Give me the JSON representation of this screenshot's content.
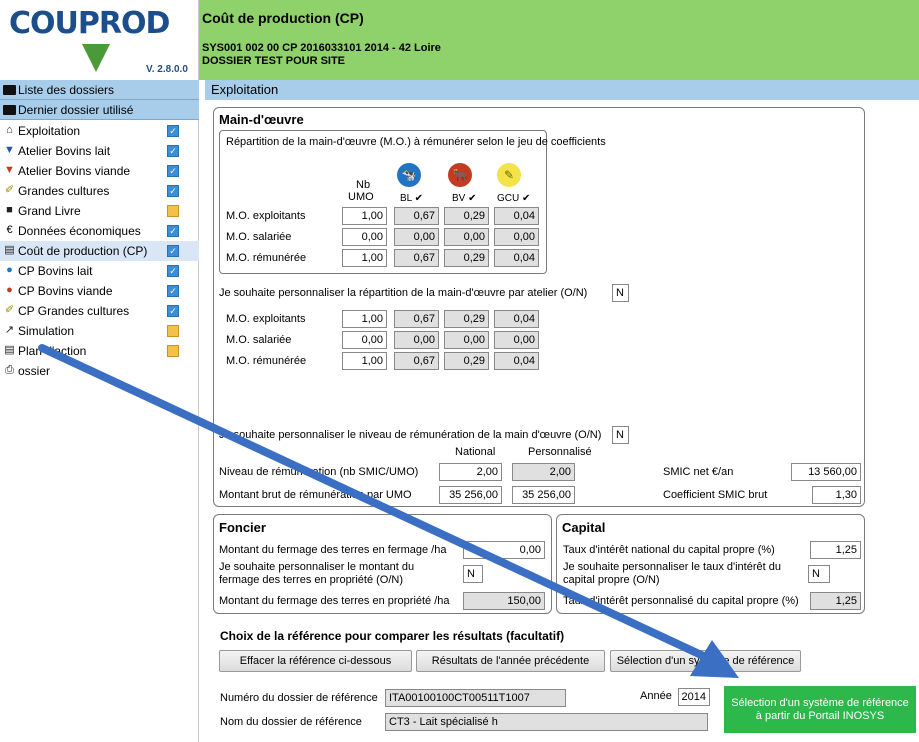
{
  "logo": {
    "text": "COUPROD",
    "version": "V. 2.8.0.0"
  },
  "header": {
    "title": "Coût de production (CP)",
    "line1": "SYS001 002 00 CP 2016033101 2014 - 42  Loire",
    "line2": "DOSSIER TEST POUR SITE"
  },
  "sidebar": {
    "head1": "Liste des dossiers",
    "head2": "Dernier dossier utilisé",
    "items": [
      {
        "label": "Exploitation",
        "icon": "home-icon",
        "check": "checked"
      },
      {
        "label": "Atelier Bovins lait",
        "icon": "cow-head-icon",
        "check": "checked"
      },
      {
        "label": "Atelier Bovins viande",
        "icon": "cow-head-icon",
        "check": "checked"
      },
      {
        "label": "Grandes cultures",
        "icon": "wheat-icon",
        "check": "checked"
      },
      {
        "label": "Grand Livre",
        "icon": "book-icon",
        "check": "pending"
      },
      {
        "label": "Données économiques",
        "icon": "euro-icon",
        "check": "checked"
      },
      {
        "label": "Coût de production (CP)",
        "icon": "calculator-icon",
        "check": "checked"
      },
      {
        "label": "CP Bovins lait",
        "icon": "cow-icon",
        "check": "checked"
      },
      {
        "label": "CP Bovins viande",
        "icon": "cow-icon",
        "check": "checked"
      },
      {
        "label": "CP Grandes cultures",
        "icon": "wheat-icon",
        "check": "checked"
      },
      {
        "label": "Simulation",
        "icon": "chart-line-icon",
        "check": "pending"
      },
      {
        "label": "Plan d'action",
        "icon": "document-icon",
        "check": "pending"
      },
      {
        "label": "ossier",
        "icon": "print-icon",
        "check": "none"
      }
    ]
  },
  "main_bar": "Exploitation",
  "mo": {
    "title": "Main-d'œuvre",
    "sub": "Répartition de la main-d'œuvre (M.O.) à rémunérer selon le jeu de coefficients",
    "col_nb": "Nb",
    "col_umo": "UMO",
    "col_bl": "BL ✔",
    "col_bv": "BV ✔",
    "col_gcu": "GCU ✔",
    "rows1": [
      {
        "label": "M.O. exploitants",
        "v": [
          "1,00",
          "0,67",
          "0,29",
          "0,04"
        ]
      },
      {
        "label": "M.O. salariée",
        "v": [
          "0,00",
          "0,00",
          "0,00",
          "0,00"
        ]
      },
      {
        "label": "M.O. rémunérée",
        "v": [
          "1,00",
          "0,67",
          "0,29",
          "0,04"
        ]
      }
    ],
    "perso_q": "Je souhaite personnaliser la répartition de la main-d'œuvre par atelier (O/N)",
    "perso_v": "N",
    "rows2": [
      {
        "label": "M.O. exploitants",
        "v": [
          "1,00",
          "0,67",
          "0,29",
          "0,04"
        ]
      },
      {
        "label": "M.O. salariée",
        "v": [
          "0,00",
          "0,00",
          "0,00",
          "0,00"
        ]
      },
      {
        "label": "M.O. rémunérée",
        "v": [
          "1,00",
          "0,67",
          "0,29",
          "0,04"
        ]
      }
    ],
    "remu_q": "Je souhaite personnaliser le niveau de rémunération de la main d'œuvre (O/N)",
    "remu_v": "N",
    "col_nat": "National",
    "col_pers": "Personnalisé",
    "niv_label": "Niveau de rémunération (nb SMIC/UMO)",
    "niv_nat": "2,00",
    "niv_pers": "2,00",
    "mont_label": "Montant brut de rémunération par UMO",
    "mont_nat": "35 256,00",
    "mont_pers": "35 256,00",
    "smic_label": "SMIC net €/an",
    "smic_v": "13 560,00",
    "coef_label": "Coefficient SMIC brut",
    "coef_v": "1,30"
  },
  "foncier": {
    "title": "Foncier",
    "l1": "Montant du fermage des terres en fermage /ha",
    "v1": "0,00",
    "l2a": "Je souhaite personnaliser le montant du",
    "l2b": "fermage des terres en propriété (O/N)",
    "v2": "N",
    "l3": "Montant du fermage des terres en propriété /ha",
    "v3": "150,00"
  },
  "capital": {
    "title": "Capital",
    "l1": "Taux d'intérêt national du capital propre (%)",
    "v1": "1,25",
    "l2a": "Je souhaite personnaliser le taux d'intérêt du",
    "l2b": "capital propre (O/N)",
    "v2": "N",
    "l3": "Taux d'intérêt personnalisé du capital propre (%)",
    "v3": "1,25"
  },
  "ref": {
    "title": "Choix de la référence pour comparer les résultats (facultatif)",
    "btn1": "Effacer la référence ci-dessous",
    "btn2": "Résultats de l'année précédente",
    "btn3": "Sélection d'un système de référence",
    "num_label": "Numéro du dossier de référence",
    "num_v": "ITA00100100CT00511T1007",
    "annee_label": "Année",
    "annee_v": "2014",
    "nom_label": "Nom du dossier de référence",
    "nom_v": "CT3 - Lait spécialisé h",
    "green_btn_l1": "Sélection d'un système de référence",
    "green_btn_l2": "à partir du Portail INOSYS"
  },
  "colors": {
    "header": "#8fd16a",
    "sidebar_head": "#a7cdea",
    "brand": "#1c4e8c",
    "green_btn": "#2db84b",
    "arrow": "#3a6fc4"
  }
}
